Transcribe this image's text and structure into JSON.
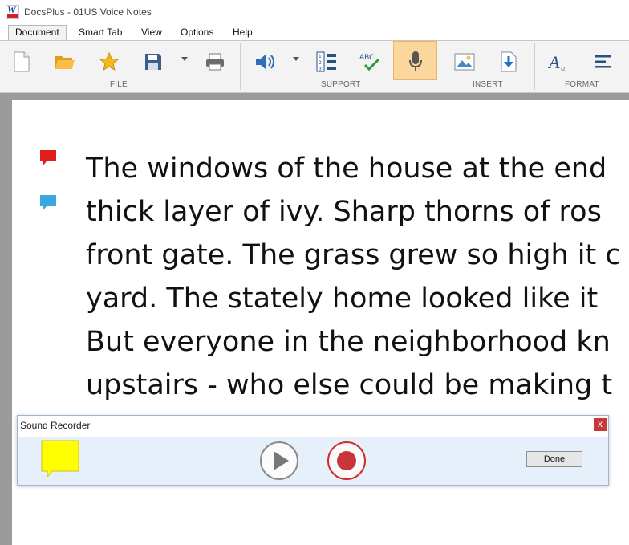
{
  "window": {
    "title": "DocsPlus - 01US Voice Notes"
  },
  "menu": {
    "items": [
      "Document",
      "Smart Tab",
      "View",
      "Options",
      "Help"
    ]
  },
  "ribbon": {
    "groups": [
      "FILE",
      "SUPPORT",
      "INSERT",
      "FORMAT"
    ],
    "support_abc": "ABC",
    "active_tool": "microphone-icon"
  },
  "document": {
    "lines": [
      "The windows of the house at the end",
      "thick layer of ivy. Sharp thorns of ros",
      "front gate. The grass grew so high it c",
      "yard. The stately home looked like it",
      "But everyone in the neighborhood kn",
      "upstairs - who else could be making t"
    ],
    "comment_colors": [
      "#e21d1d",
      "#3aa7e0"
    ]
  },
  "sound_recorder": {
    "title": "Sound Recorder",
    "close_label": "x",
    "done_label": "Done",
    "note_color": "#ffff00"
  }
}
